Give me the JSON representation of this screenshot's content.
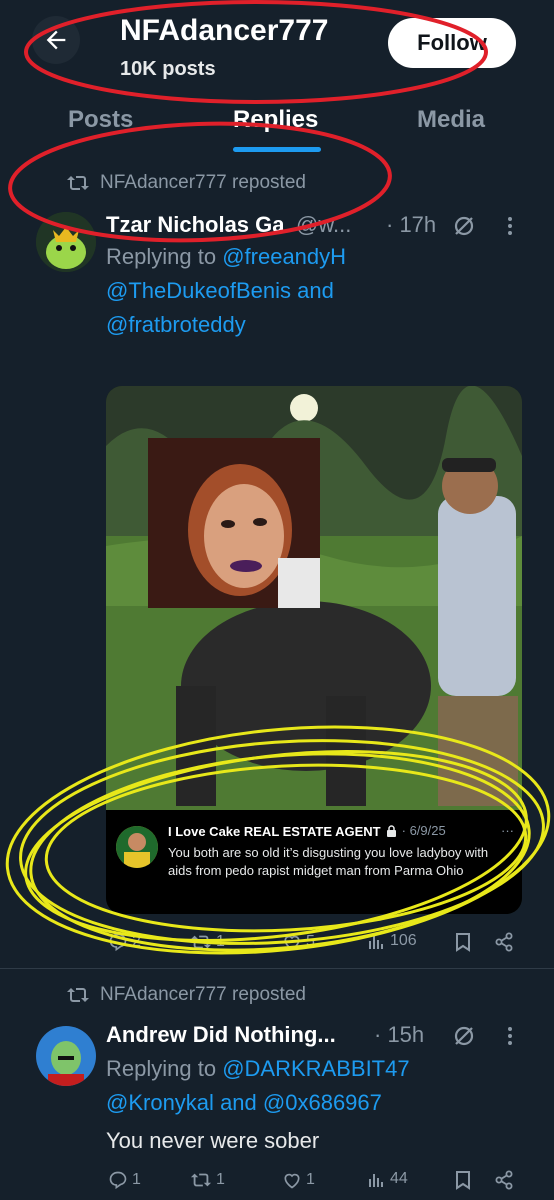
{
  "header": {
    "title": "NFAdancer777",
    "subtitle": "10K posts",
    "follow_label": "Follow"
  },
  "tabs": [
    {
      "label": "Posts",
      "active": false
    },
    {
      "label": "Replies",
      "active": true
    },
    {
      "label": "Media",
      "active": false
    }
  ],
  "post1": {
    "repost_text": "NFAdancer777 reposted",
    "author_name": "Tzar Nicholas Ga",
    "handle": "@w...",
    "time": "· 17h",
    "replying_prefix": "Replying to",
    "reply_handle_1": "@freeandyH",
    "reply_handle_2": "@TheDukeofBenis",
    "reply_and": "and",
    "reply_handle_3": "@fratbroteddy",
    "quote": {
      "name": "I Love Cake REAL ESTATE AGENT",
      "date": "· 6/9/25",
      "more": "···",
      "text": "You both are so old it’s disgusting you love ladyboy with aids from pedo rapist midget man from Parma Ohio"
    },
    "actions": {
      "replies": "2",
      "reposts": "1",
      "likes": "5",
      "views": "106"
    }
  },
  "post2": {
    "repost_text": "NFAdancer777 reposted",
    "author_name": "Andrew Did Nothing...",
    "time": "· 15h",
    "replying_prefix": "Replying to",
    "reply_handle_1": "@DARKRABBIT47",
    "reply_handle_2": "@Kronykal",
    "reply_and": "and",
    "reply_handle_3": "@0x686967",
    "text": "You never were sober",
    "actions": {
      "replies": "1",
      "reposts": "1",
      "likes": "1",
      "views": "44"
    }
  },
  "colors": {
    "background": "#15202b",
    "accent": "#1d9bf0",
    "annotation_red": "#e0202a",
    "annotation_yellow": "#e8e81a"
  },
  "icons": [
    "back-arrow-icon",
    "retweet-icon",
    "grok-icon",
    "more-icon",
    "reply-icon",
    "like-icon",
    "views-icon",
    "bookmark-icon",
    "share-icon",
    "lock-icon"
  ]
}
